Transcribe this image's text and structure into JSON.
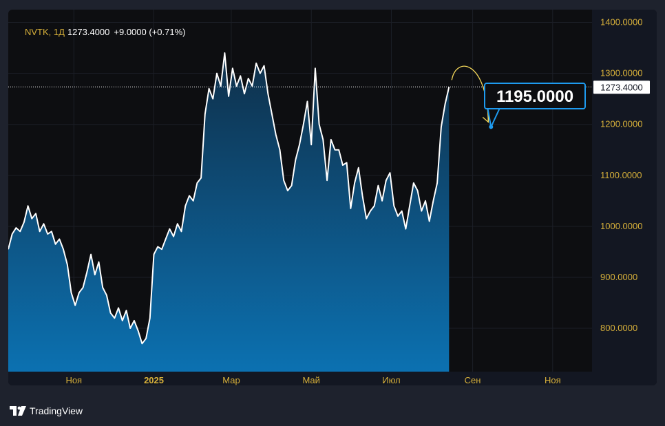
{
  "legend": {
    "symbol": "NVTK, 1Д",
    "last": "1273.4000",
    "change": "+9.0000 (+0.71%)"
  },
  "brand": {
    "name": "TradingView",
    "icon": "tradingview-logo-icon"
  },
  "colors": {
    "bg": "#1e222d",
    "plot_bg": "#0d0e11",
    "line": "#ffffff",
    "area_top": "#0f2f49",
    "area_bottom": "#0c71b1",
    "axis_text": "#d7b03a",
    "accent": "#1e9bf0",
    "arrow": "#f3d75a"
  },
  "chart_data": {
    "type": "area",
    "title": "",
    "xlabel": "",
    "ylabel": "",
    "ylim": [
      715,
      1425
    ],
    "y_ticks": [
      800,
      900,
      1000,
      1100,
      1200,
      1300,
      1400
    ],
    "y_tick_labels": [
      "800.0000",
      "900.0000",
      "1000.0000",
      "1100.0000",
      "1200.0000",
      "1300.0000",
      "1400.0000"
    ],
    "x_range": [
      "2024-09-12",
      "2025-12-01"
    ],
    "x_ticks": [
      {
        "date": "2024-11-01",
        "label": "Ноя",
        "bold": false
      },
      {
        "date": "2025-01-01",
        "label": "2025",
        "bold": true
      },
      {
        "date": "2025-03-01",
        "label": "Мар",
        "bold": false
      },
      {
        "date": "2025-05-01",
        "label": "Май",
        "bold": false
      },
      {
        "date": "2025-07-01",
        "label": "Июл",
        "bold": false
      },
      {
        "date": "2025-09-01",
        "label": "Сен",
        "bold": false
      },
      {
        "date": "2025-11-01",
        "label": "Ноя",
        "bold": false
      }
    ],
    "last_price": 1273.4,
    "last_price_label": "1273.4000",
    "target": {
      "date": "2025-09-15",
      "value": 1195,
      "label": "1195.0000"
    },
    "grid": true,
    "series": [
      {
        "points": [
          [
            "2024-09-12",
            955
          ],
          [
            "2024-09-15",
            985
          ],
          [
            "2024-09-18",
            997
          ],
          [
            "2024-09-21",
            990
          ],
          [
            "2024-09-24",
            1008
          ],
          [
            "2024-09-27",
            1040
          ],
          [
            "2024-09-30",
            1015
          ],
          [
            "2024-10-03",
            1025
          ],
          [
            "2024-10-06",
            990
          ],
          [
            "2024-10-09",
            1005
          ],
          [
            "2024-10-12",
            985
          ],
          [
            "2024-10-15",
            990
          ],
          [
            "2024-10-18",
            965
          ],
          [
            "2024-10-21",
            975
          ],
          [
            "2024-10-24",
            955
          ],
          [
            "2024-10-27",
            925
          ],
          [
            "2024-10-30",
            870
          ],
          [
            "2024-11-02",
            845
          ],
          [
            "2024-11-05",
            870
          ],
          [
            "2024-11-08",
            880
          ],
          [
            "2024-11-11",
            910
          ],
          [
            "2024-11-14",
            945
          ],
          [
            "2024-11-17",
            905
          ],
          [
            "2024-11-20",
            930
          ],
          [
            "2024-11-23",
            880
          ],
          [
            "2024-11-26",
            865
          ],
          [
            "2024-11-29",
            830
          ],
          [
            "2024-12-02",
            820
          ],
          [
            "2024-12-05",
            840
          ],
          [
            "2024-12-08",
            815
          ],
          [
            "2024-12-11",
            835
          ],
          [
            "2024-12-14",
            800
          ],
          [
            "2024-12-17",
            815
          ],
          [
            "2024-12-20",
            795
          ],
          [
            "2024-12-23",
            770
          ],
          [
            "2024-12-26",
            780
          ],
          [
            "2024-12-29",
            820
          ],
          [
            "2025-01-01",
            945
          ],
          [
            "2025-01-04",
            960
          ],
          [
            "2025-01-07",
            955
          ],
          [
            "2025-01-10",
            975
          ],
          [
            "2025-01-13",
            995
          ],
          [
            "2025-01-16",
            980
          ],
          [
            "2025-01-19",
            1005
          ],
          [
            "2025-01-22",
            990
          ],
          [
            "2025-01-25",
            1040
          ],
          [
            "2025-01-28",
            1060
          ],
          [
            "2025-01-31",
            1050
          ],
          [
            "2025-02-03",
            1085
          ],
          [
            "2025-02-06",
            1095
          ],
          [
            "2025-02-09",
            1220
          ],
          [
            "2025-02-12",
            1270
          ],
          [
            "2025-02-15",
            1250
          ],
          [
            "2025-02-18",
            1300
          ],
          [
            "2025-02-21",
            1275
          ],
          [
            "2025-02-24",
            1340
          ],
          [
            "2025-02-27",
            1255
          ],
          [
            "2025-03-02",
            1310
          ],
          [
            "2025-03-05",
            1275
          ],
          [
            "2025-03-08",
            1295
          ],
          [
            "2025-03-11",
            1260
          ],
          [
            "2025-03-14",
            1290
          ],
          [
            "2025-03-17",
            1275
          ],
          [
            "2025-03-20",
            1320
          ],
          [
            "2025-03-23",
            1300
          ],
          [
            "2025-03-26",
            1315
          ],
          [
            "2025-03-29",
            1260
          ],
          [
            "2025-04-01",
            1220
          ],
          [
            "2025-04-04",
            1180
          ],
          [
            "2025-04-07",
            1150
          ],
          [
            "2025-04-10",
            1090
          ],
          [
            "2025-04-13",
            1070
          ],
          [
            "2025-04-16",
            1080
          ],
          [
            "2025-04-19",
            1130
          ],
          [
            "2025-04-22",
            1160
          ],
          [
            "2025-04-25",
            1200
          ],
          [
            "2025-04-28",
            1245
          ],
          [
            "2025-05-01",
            1160
          ],
          [
            "2025-05-04",
            1310
          ],
          [
            "2025-05-07",
            1200
          ],
          [
            "2025-05-10",
            1170
          ],
          [
            "2025-05-13",
            1090
          ],
          [
            "2025-05-16",
            1170
          ],
          [
            "2025-05-19",
            1150
          ],
          [
            "2025-05-22",
            1150
          ],
          [
            "2025-05-25",
            1120
          ],
          [
            "2025-05-28",
            1125
          ],
          [
            "2025-05-31",
            1035
          ],
          [
            "2025-06-03",
            1085
          ],
          [
            "2025-06-06",
            1115
          ],
          [
            "2025-06-09",
            1060
          ],
          [
            "2025-06-12",
            1015
          ],
          [
            "2025-06-15",
            1030
          ],
          [
            "2025-06-18",
            1040
          ],
          [
            "2025-06-21",
            1080
          ],
          [
            "2025-06-24",
            1050
          ],
          [
            "2025-06-27",
            1090
          ],
          [
            "2025-06-30",
            1105
          ],
          [
            "2025-07-03",
            1040
          ],
          [
            "2025-07-06",
            1020
          ],
          [
            "2025-07-09",
            1030
          ],
          [
            "2025-07-12",
            995
          ],
          [
            "2025-07-15",
            1040
          ],
          [
            "2025-07-18",
            1085
          ],
          [
            "2025-07-21",
            1070
          ],
          [
            "2025-07-24",
            1030
          ],
          [
            "2025-07-27",
            1050
          ],
          [
            "2025-07-30",
            1010
          ],
          [
            "2025-08-02",
            1050
          ],
          [
            "2025-08-05",
            1085
          ],
          [
            "2025-08-08",
            1195
          ],
          [
            "2025-08-11",
            1240
          ],
          [
            "2025-08-14",
            1273.4
          ]
        ]
      }
    ]
  }
}
